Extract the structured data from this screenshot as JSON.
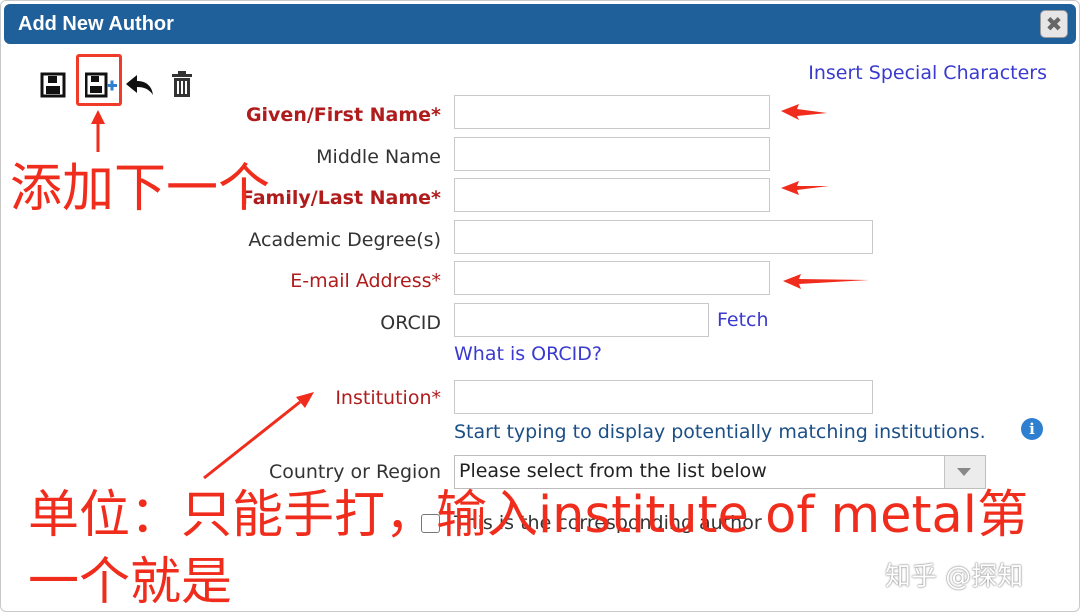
{
  "dialog": {
    "title": "Add New Author",
    "close_glyph": "✖"
  },
  "toolbar": {
    "icons": [
      "save-icon",
      "save-and-add-next-icon",
      "undo-icon",
      "trash-icon"
    ],
    "special_chars_link": "Insert Special Characters"
  },
  "form": {
    "given_name_label": "Given/First Name*",
    "middle_name_label": "Middle Name",
    "family_name_label": "Family/Last Name*",
    "degree_label": "Academic Degree(s)",
    "email_label": "E-mail Address*",
    "orcid_label": "ORCID",
    "fetch_link": "Fetch",
    "what_is_orcid_link": "What is ORCID?",
    "institution_label": "Institution*",
    "institution_hint": "Start typing to display potentially matching institutions.",
    "info_glyph": "i",
    "country_label": "Country or Region",
    "country_select_value": "Please select from the list below",
    "corresponding_label": "This is the corresponding author",
    "corresponding_checked": false
  },
  "annotations": {
    "add_next": "添加下一个",
    "institution_note_line1": "单位：只能手打，输入institute of metal第",
    "institution_note_line2": "一个就是"
  },
  "watermark": "知乎 @探知",
  "colors": {
    "titlebar": "#1f5f9a",
    "required_label": "#b01c1c",
    "link": "#3a3acf",
    "annotation_red": "#f02c1c"
  }
}
